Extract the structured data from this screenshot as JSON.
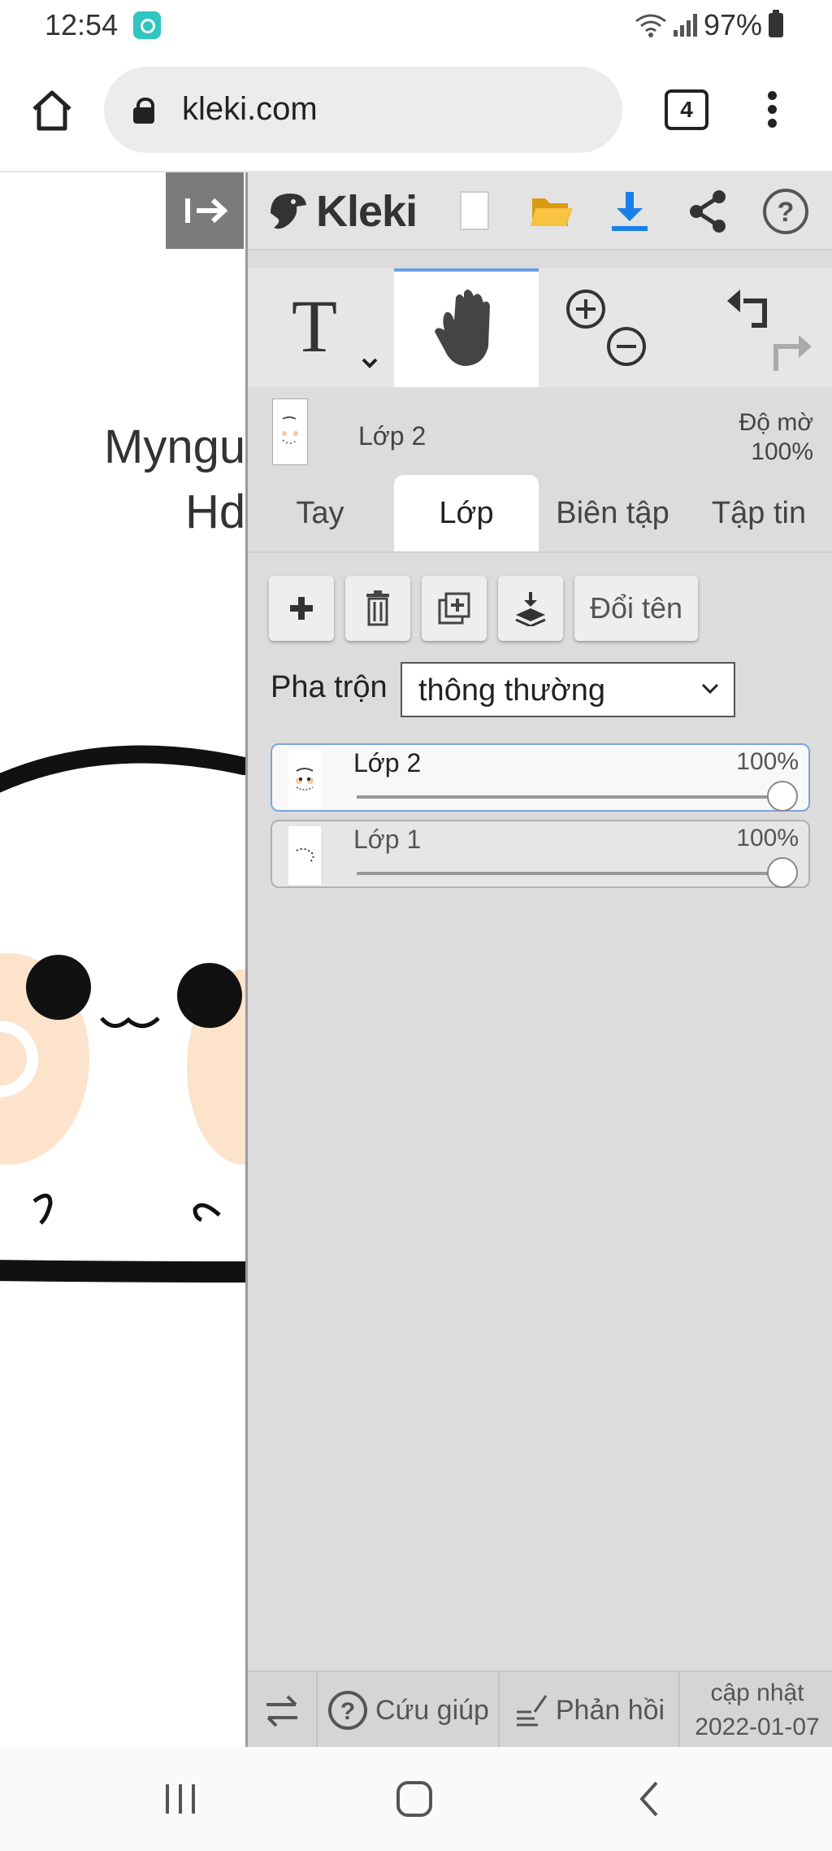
{
  "status": {
    "time": "12:54",
    "battery": "97%"
  },
  "browser": {
    "url": "kleki.com",
    "tab_count": "4"
  },
  "canvas": {
    "line1": "Myngu",
    "line2": "Hd"
  },
  "app": {
    "logo": "Kleki"
  },
  "layer_header": {
    "name": "Lớp 2",
    "opacity_label": "Độ mờ",
    "opacity_value": "100%"
  },
  "tabs": [
    {
      "label": "Tay"
    },
    {
      "label": "Lớp"
    },
    {
      "label": "Biên tập"
    },
    {
      "label": "Tập tin"
    }
  ],
  "layer_actions": {
    "rename_label": "Đổi tên"
  },
  "blend": {
    "label": "Pha trộn",
    "value": "thông thường"
  },
  "layers": [
    {
      "name": "Lớp 2",
      "opacity": "100%",
      "opacity_value": 1.0
    },
    {
      "name": "Lớp 1",
      "opacity": "100%",
      "opacity_value": 1.0
    }
  ],
  "footer": {
    "help": "Cứu giúp",
    "feedback": "Phản hồi",
    "update_label": "cập nhật",
    "update_date": "2022-01-07"
  },
  "colors": {
    "accent": "#6b9ee8",
    "download": "#1a7fe8",
    "folder": "#f2b82c"
  }
}
